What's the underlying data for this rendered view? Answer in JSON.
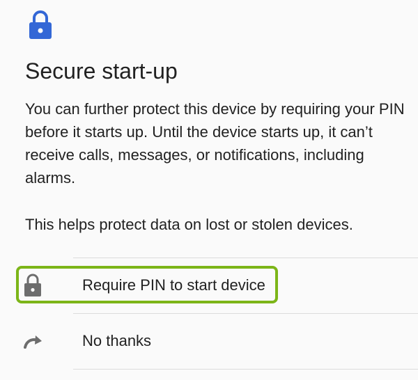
{
  "header": {
    "icon": "lock-icon",
    "icon_color": "#3367d6"
  },
  "title": "Secure start-up",
  "description": "You can further protect this device by requiring your PIN before it starts up. Until the device starts up, it can’t receive calls, messages, or notifications, including alarms.",
  "description_secondary": "This helps protect data on lost or stolen devices.",
  "options": [
    {
      "icon": "lock-icon",
      "label": "Require PIN to start device",
      "highlighted": true
    },
    {
      "icon": "redo-arrow-icon",
      "label": "No thanks",
      "highlighted": false
    }
  ],
  "colors": {
    "accent": "#3367d6",
    "highlight": "#7cb518",
    "icon_gray": "#6d6d6d",
    "text": "#212121"
  }
}
